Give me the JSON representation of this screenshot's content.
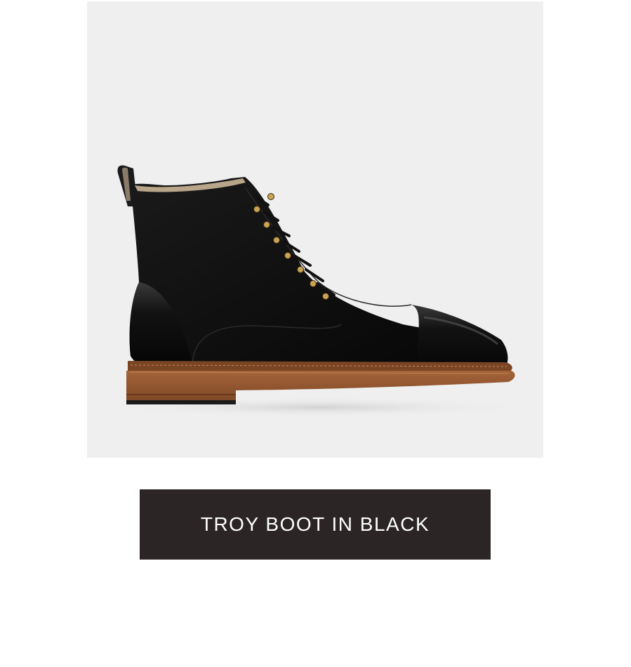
{
  "product": {
    "image_subject": "boot-image",
    "button_label": "TROY BOOT IN BLACK"
  },
  "colors": {
    "image_background": "#efefef",
    "button_background": "#2b2526",
    "button_text": "#ffffff"
  }
}
